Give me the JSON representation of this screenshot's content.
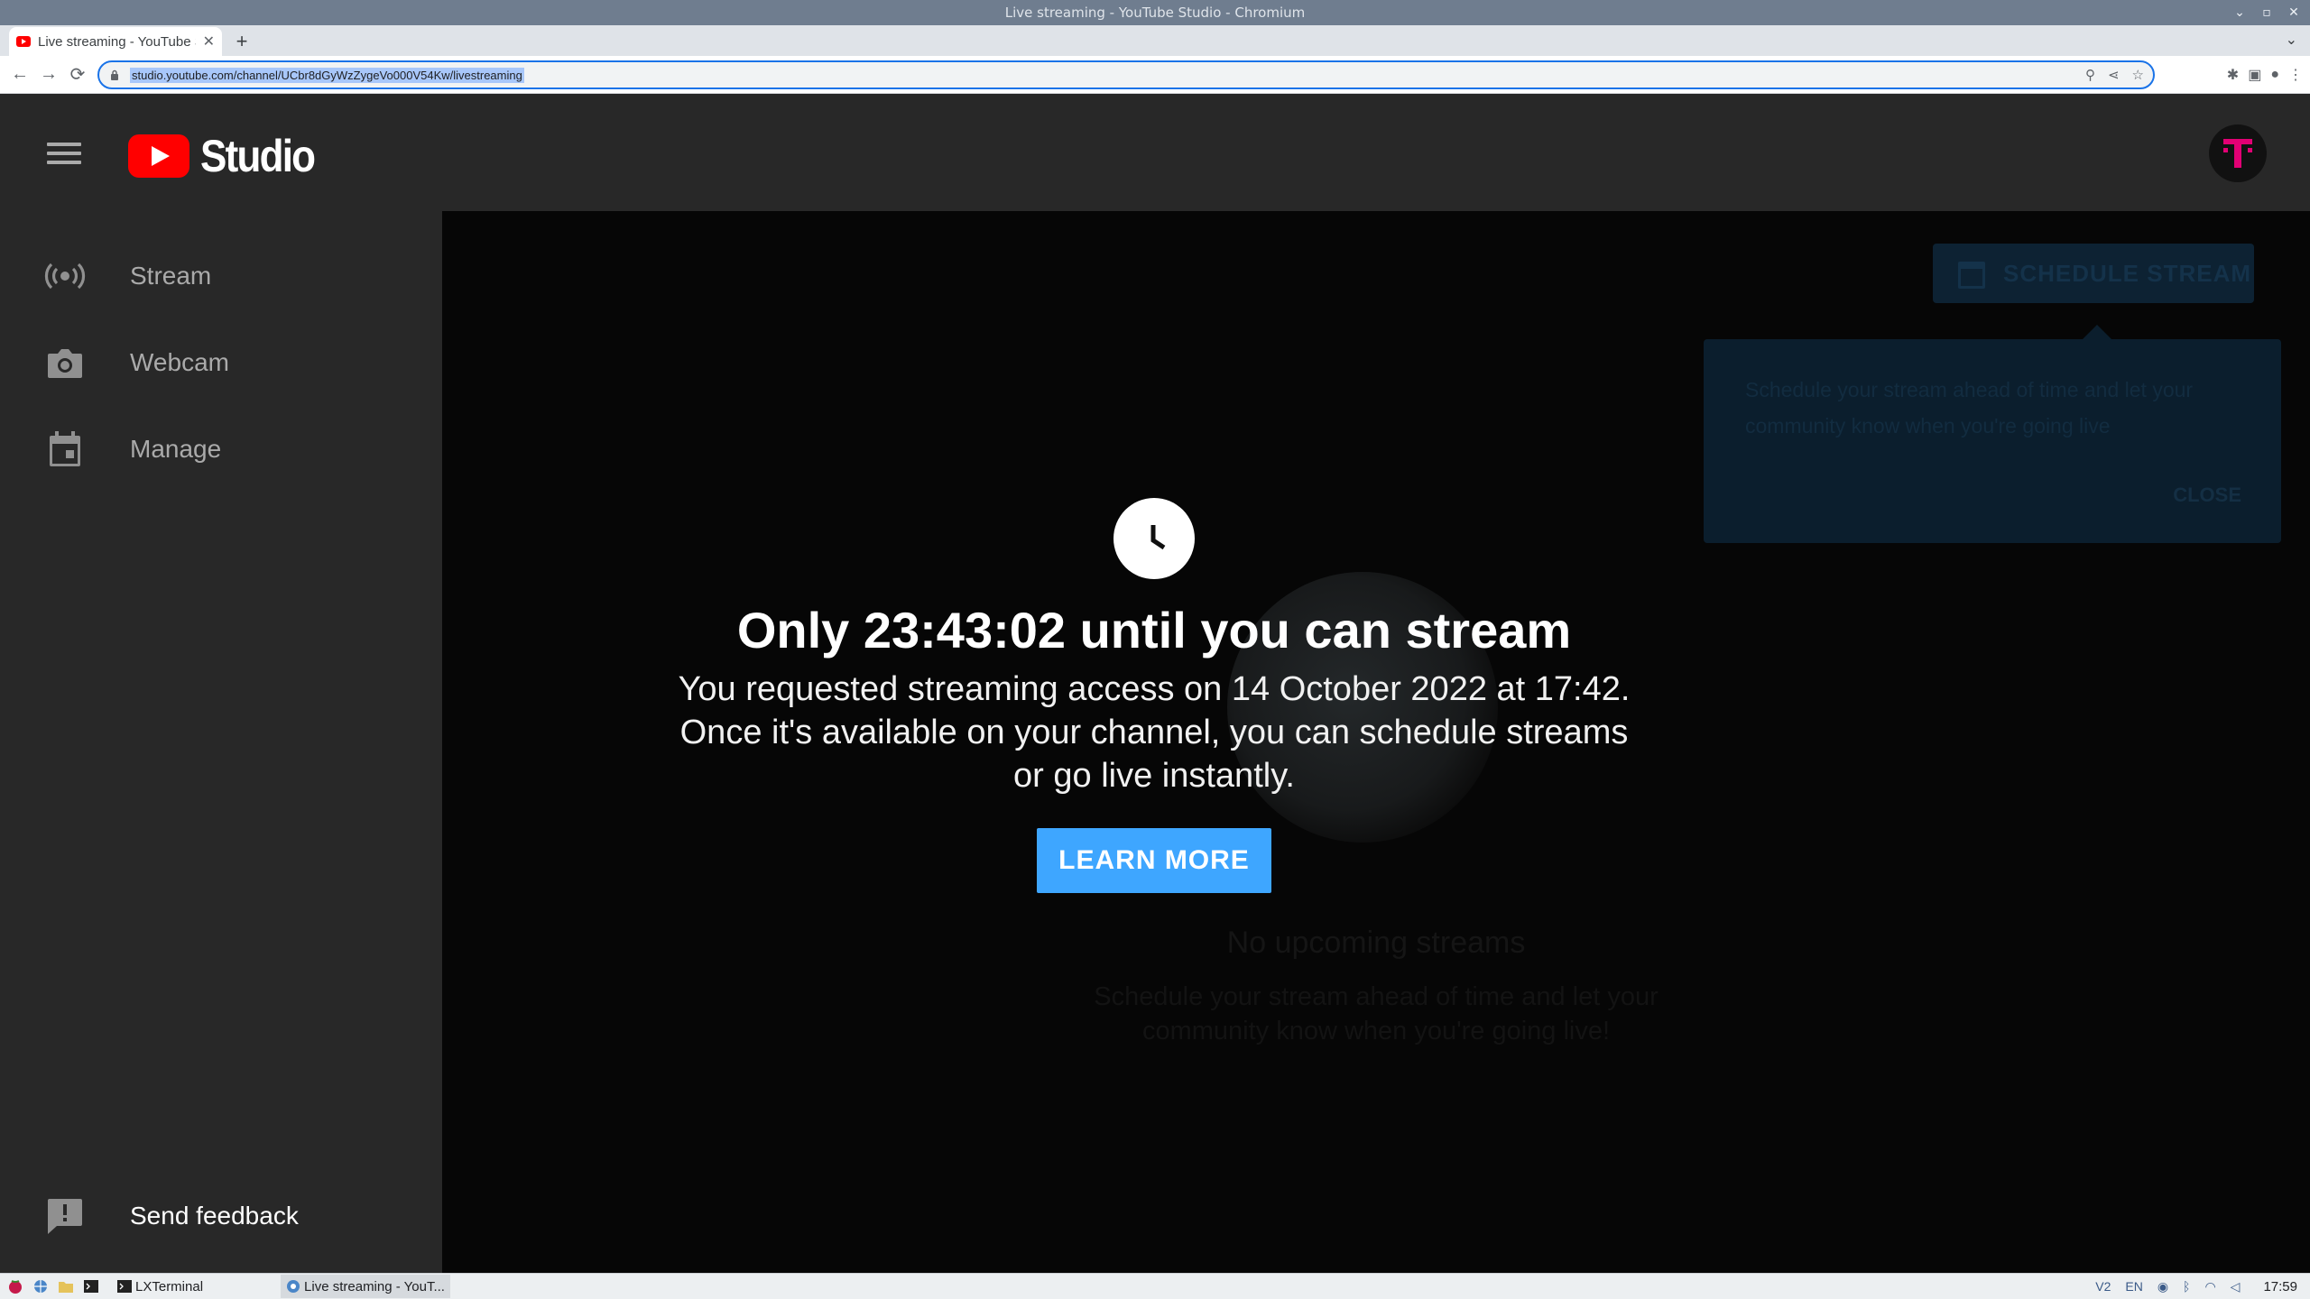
{
  "window": {
    "title": "Live streaming - YouTube Studio - Chromium",
    "minimize": "⌄",
    "maximize": "▫",
    "close": "✕"
  },
  "browser": {
    "tab_title": "Live streaming - YouTube Studio",
    "url": "studio.youtube.com/channel/UCbr8dGyWzZygeVo000V54Kw/livestreaming"
  },
  "header": {
    "logo_text": "Studio",
    "avatar_letter": "T",
    "avatar_color": "#e20074"
  },
  "sidebar": {
    "items": [
      {
        "label": "Stream",
        "icon": "stream-icon"
      },
      {
        "label": "Webcam",
        "icon": "camera-icon"
      },
      {
        "label": "Manage",
        "icon": "calendar-icon"
      }
    ],
    "feedback_label": "Send feedback"
  },
  "notice": {
    "title": "Only 23:43:02 until you can stream",
    "body": "You requested streaming access on 14 October 2022 at 17:42. Once it's available on your channel, you can schedule streams or go live instantly.",
    "button_label": "LEARN MORE",
    "accent": "#3ea6ff"
  },
  "background": {
    "schedule_button": "SCHEDULE STREAM",
    "tooltip_text": "Schedule your stream ahead of time and let your community know when you're going live",
    "tooltip_close": "CLOSE",
    "empty_title": "No upcoming streams",
    "empty_sub": "Schedule your stream ahead of time and let your community know when you're going live!"
  },
  "taskbar": {
    "tasks": [
      {
        "label": "LXTerminal"
      },
      {
        "label": "Live streaming - YouT..."
      }
    ],
    "lang": "EN",
    "time": "17:59"
  }
}
